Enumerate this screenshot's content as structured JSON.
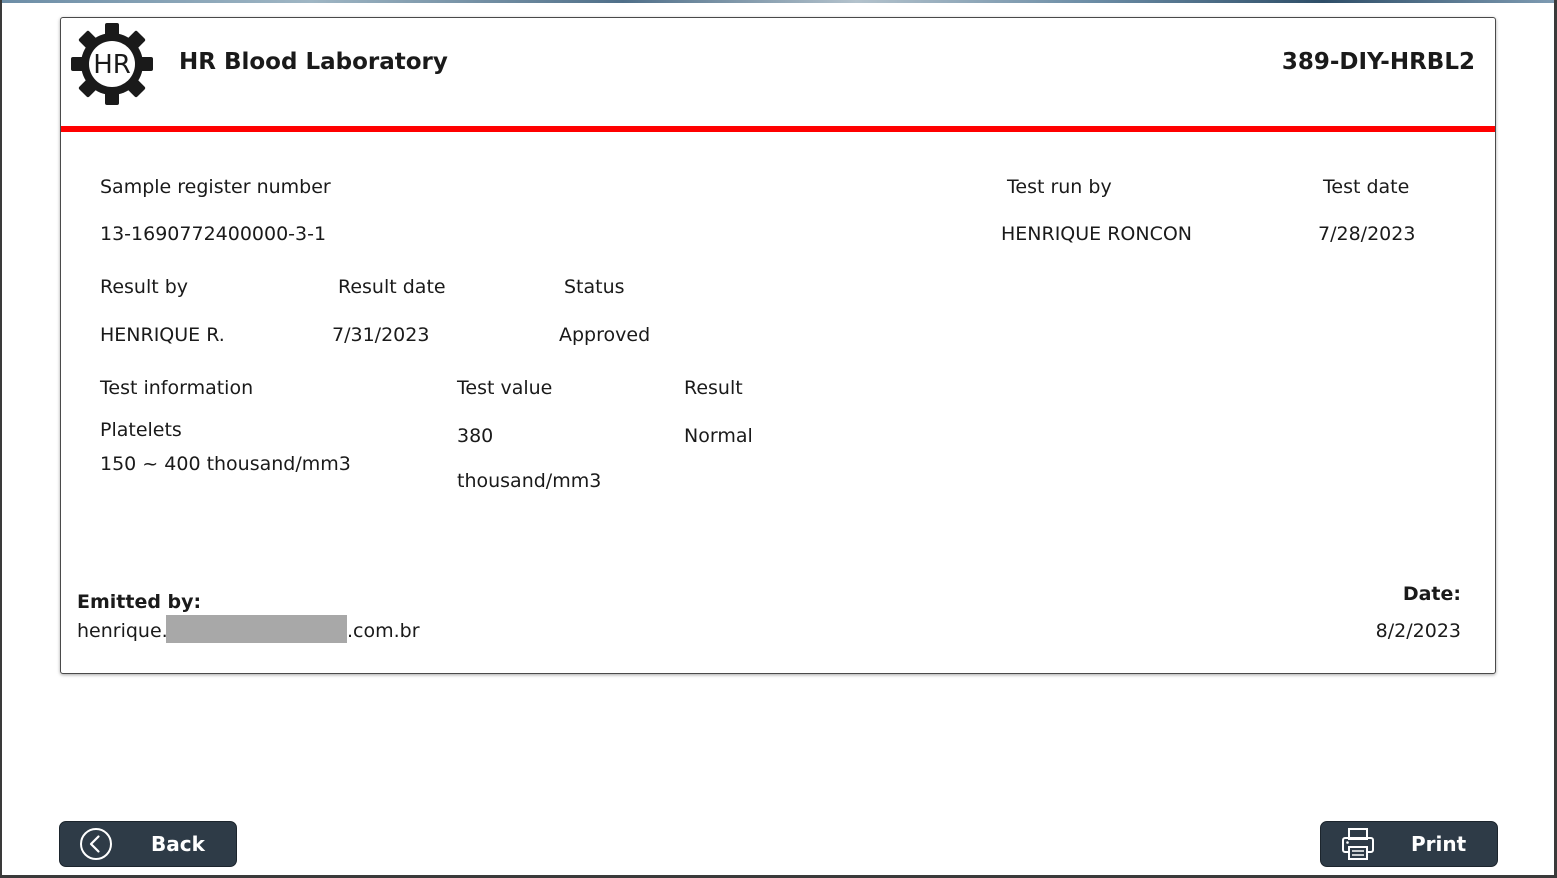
{
  "header": {
    "lab_name": "HR Blood Laboratory",
    "report_code": "389-DIY-HRBL2",
    "logo_icon": "gear-hr-logo",
    "logo_text": "HR",
    "accent_color": "#ff0000"
  },
  "sample": {
    "register_label": "Sample register number",
    "register_value": "13-1690772400000-3-1",
    "test_run_by_label": "Test run by",
    "test_run_by_value": "HENRIQUE RONCON",
    "test_date_label": "Test date",
    "test_date_value": "7/28/2023"
  },
  "result_info": {
    "result_by_label": "Result by",
    "result_by_value": "HENRIQUE R.",
    "result_date_label": "Result date",
    "result_date_value": "7/31/2023",
    "status_label": "Status",
    "status_value": "Approved"
  },
  "test": {
    "info_label": "Test information",
    "value_label": "Test value",
    "result_label": "Result",
    "name": "Platelets",
    "reference_range": "150 ~ 400 thousand/mm3",
    "value": "380",
    "unit": "thousand/mm3",
    "result": "Normal"
  },
  "footer": {
    "emitted_by_label": "Emitted by:",
    "email_prefix": "henrique.",
    "email_suffix": ".com.br",
    "date_label": "Date:",
    "date_value": "8/2/2023"
  },
  "buttons": {
    "back_label": "Back",
    "back_icon": "chevron-left-circle-icon",
    "print_label": "Print",
    "print_icon": "printer-icon",
    "button_color": "#2e3b47"
  }
}
